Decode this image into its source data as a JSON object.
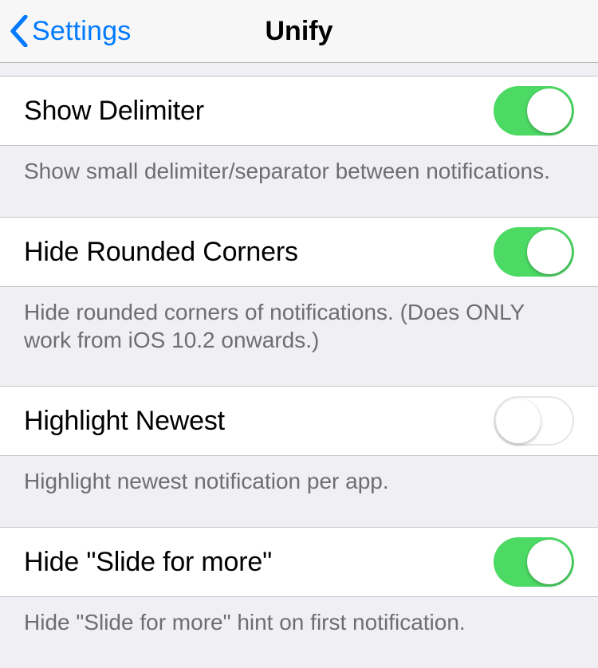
{
  "nav": {
    "back_label": "Settings",
    "title": "Unify"
  },
  "rows": [
    {
      "label": "Show Delimiter",
      "on": true,
      "footer": "Show small delimiter/separator between notifications."
    },
    {
      "label": "Hide Rounded Corners",
      "on": true,
      "footer": "Hide rounded corners of notifications. (Does ONLY work from iOS 10.2 onwards.)"
    },
    {
      "label": "Highlight Newest",
      "on": false,
      "footer": "Highlight newest notification per app."
    },
    {
      "label": "Hide \"Slide for more\"",
      "on": true,
      "footer": "Hide \"Slide for more\" hint on first notification."
    }
  ]
}
